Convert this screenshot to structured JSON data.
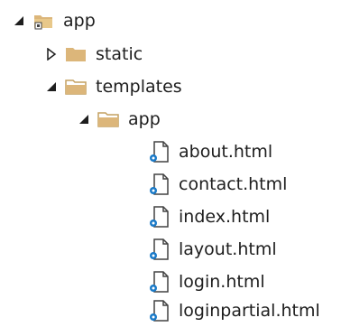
{
  "tree": {
    "root": {
      "label": "app",
      "expanded": true,
      "icon": "project-folder-icon"
    },
    "items": [
      {
        "label": "static",
        "type": "folder",
        "expanded": false,
        "icon": "folder-closed-icon"
      },
      {
        "label": "templates",
        "type": "folder",
        "expanded": true,
        "icon": "folder-open-icon"
      },
      {
        "label": "app",
        "type": "folder",
        "expanded": true,
        "icon": "folder-open-icon"
      },
      {
        "label": "about.html",
        "type": "file",
        "icon": "html-file-icon"
      },
      {
        "label": "contact.html",
        "type": "file",
        "icon": "html-file-icon"
      },
      {
        "label": "index.html",
        "type": "file",
        "icon": "html-file-icon"
      },
      {
        "label": "layout.html",
        "type": "file",
        "icon": "html-file-icon"
      },
      {
        "label": "login.html",
        "type": "file",
        "icon": "html-file-icon"
      },
      {
        "label": "loginpartial.html",
        "type": "file",
        "icon": "html-file-icon"
      }
    ]
  },
  "colors": {
    "text": "#1e1e1e",
    "folder": "#dcb67a",
    "folder_dark": "#c4a060",
    "file_outline": "#424242",
    "file_badge": "#1a7ac8",
    "toggle": "#1e1e1e"
  }
}
